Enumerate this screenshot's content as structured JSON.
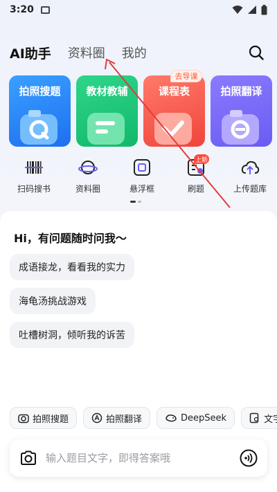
{
  "status": {
    "time": "3:20"
  },
  "nav": {
    "tabs": [
      "AI助手",
      "资料圈",
      "我的"
    ]
  },
  "cards": [
    {
      "label": "拍照搜题"
    },
    {
      "label": "教材教辅"
    },
    {
      "label": "课程表"
    },
    {
      "label": "拍照翻译"
    }
  ],
  "cards_badge": "去导课",
  "tools": [
    {
      "label": "扫码搜书"
    },
    {
      "label": "资料圈"
    },
    {
      "label": "悬浮框"
    },
    {
      "label": "刷题"
    },
    {
      "label": "上传题库"
    }
  ],
  "tools_badge": "上新",
  "chat": {
    "greeting": "Hi，有问题随时问我～",
    "suggestions": [
      "成语接龙，看看我的实力",
      "海龟汤挑战游戏",
      "吐槽树洞，倾听我的诉苦"
    ]
  },
  "quick_actions": [
    "拍照搜题",
    "拍照翻译",
    "DeepSeek",
    "文字"
  ],
  "input": {
    "placeholder": "输入题目文字，即得答案哦"
  },
  "colors": {
    "accent_red": "#ff4a3a",
    "annotation_red": "#e23b3b"
  }
}
